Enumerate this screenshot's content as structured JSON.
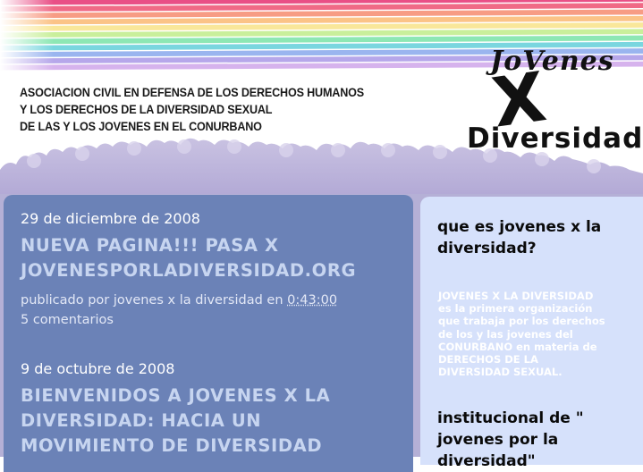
{
  "header": {
    "org_lines": [
      "ASOCIACION CIVIL EN DEFENSA DE LOS DERECHOS HUMANOS",
      "Y LOS DERECHOS DE LA DIVERSIDAD SEXUAL",
      "DE LAS Y LOS JOVENES EN EL CONURBANO"
    ],
    "logo_lines": [
      "JoVenes",
      "X",
      "Diversidad"
    ],
    "stripe_colors": [
      "#e94f86",
      "#f06a86",
      "#f79c84",
      "#fbc387",
      "#f9e79a",
      "#c9ef9b",
      "#8de7b4",
      "#7ad6df",
      "#9ab5ef",
      "#b6a7ea",
      "#d6b3ed"
    ]
  },
  "posts": [
    {
      "date": "29 de diciembre de 2008",
      "title_lines": [
        "NUEVA PAGINA!!! PASA X",
        "JOVENESPORLADIVERSIDAD.ORG"
      ],
      "published_prefix": "publicado por jovenes x la diversidad en",
      "time": "0:43:00",
      "comments": "5 comentarios"
    },
    {
      "date": "9 de octubre de 2008",
      "title_lines": [
        "BIENVENIDOS A JOVENES X LA",
        "DIVERSIDAD: HACIA UN",
        "MOVIMIENTO DE DIVERSIDAD"
      ]
    }
  ],
  "sidebar": {
    "heading": "que es jovenes x la diversidad?",
    "body_lines": [
      "JOVENES X LA DIVERSIDAD",
      "es la primera organización",
      "que trabaja por los derechos",
      "de los y las jovenes del",
      "CONURBANO en materia de",
      "DERECHOS DE LA",
      "DIVERSIDAD SEXUAL."
    ],
    "heading2_lines": [
      "institucional de \"",
      "jovenes por la",
      "diversidad\""
    ]
  }
}
